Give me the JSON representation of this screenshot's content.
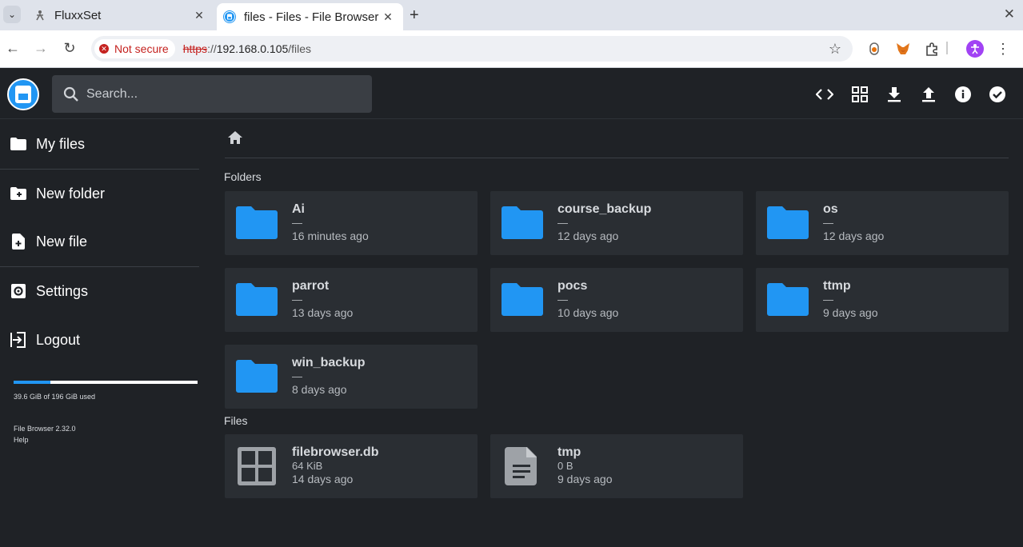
{
  "browser": {
    "tabs": [
      {
        "title": "FluxxSet",
        "icon": "person-icon"
      },
      {
        "title": "files - Files - File Browser",
        "icon": "filebrowser-icon"
      }
    ],
    "security_label": "Not secure",
    "url_protocol": "https",
    "url_sep": "://",
    "url_host": "192.168.0.105",
    "url_path": "/files"
  },
  "app": {
    "search_placeholder": "Search...",
    "header_actions": [
      "code-icon",
      "grid-view-icon",
      "download-icon",
      "upload-icon",
      "info-icon",
      "select-icon"
    ]
  },
  "sidebar": {
    "items": [
      {
        "label": "My files",
        "icon": "folder-icon"
      },
      {
        "label": "New folder",
        "icon": "new-folder-icon"
      },
      {
        "label": "New file",
        "icon": "new-file-icon"
      },
      {
        "label": "Settings",
        "icon": "settings-icon"
      },
      {
        "label": "Logout",
        "icon": "logout-icon"
      }
    ],
    "usage_text": "39.6 GiB of 196 GiB used",
    "usage_fraction": 0.202,
    "version": "File Browser 2.32.0",
    "help": "Help"
  },
  "main": {
    "folders_heading": "Folders",
    "files_heading": "Files",
    "folders": [
      {
        "name": "Ai",
        "size": "—",
        "modified": "16 minutes ago"
      },
      {
        "name": "course_backup",
        "size": "—",
        "modified": "12 days ago"
      },
      {
        "name": "os",
        "size": "—",
        "modified": "12 days ago"
      },
      {
        "name": "parrot",
        "size": "—",
        "modified": "13 days ago"
      },
      {
        "name": "pocs",
        "size": "—",
        "modified": "10 days ago"
      },
      {
        "name": "ttmp",
        "size": "—",
        "modified": "9 days ago"
      },
      {
        "name": "win_backup",
        "size": "—",
        "modified": "8 days ago"
      }
    ],
    "files": [
      {
        "name": "filebrowser.db",
        "size": "64 KiB",
        "modified": "14 days ago",
        "icon": "database-grid-icon"
      },
      {
        "name": "tmp",
        "size": "0 B",
        "modified": "9 days ago",
        "icon": "document-icon"
      }
    ]
  },
  "colors": {
    "accent": "#2196f3",
    "background": "#1f2226",
    "card": "#2a2e33"
  }
}
